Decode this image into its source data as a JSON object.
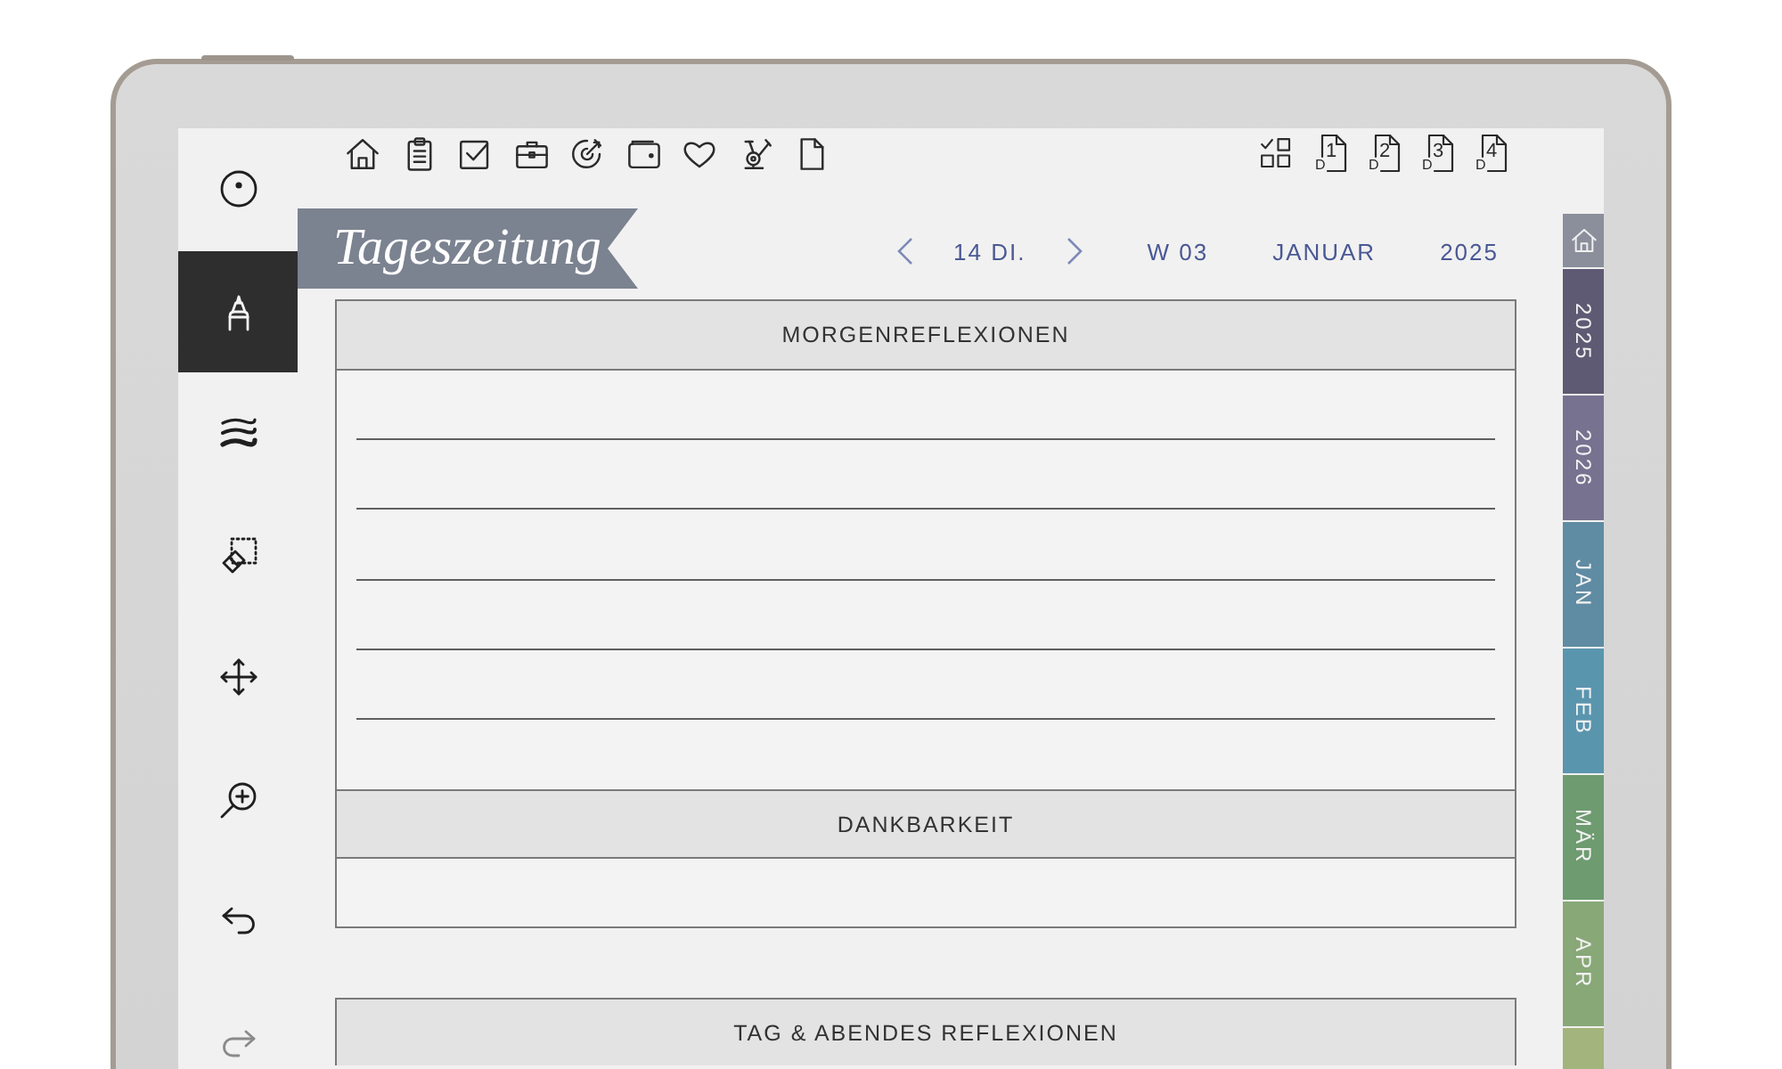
{
  "toolbar": {
    "left": [
      {
        "kind": "home"
      },
      {
        "kind": "clipboard"
      },
      {
        "kind": "checkbox"
      },
      {
        "kind": "briefcase"
      },
      {
        "kind": "target"
      },
      {
        "kind": "wallet"
      },
      {
        "kind": "heart"
      },
      {
        "kind": "bike"
      },
      {
        "kind": "page"
      }
    ],
    "right": [
      {
        "kind": "grid"
      },
      {
        "kind": "day_page",
        "letter": "D",
        "number": "1"
      },
      {
        "kind": "day_page",
        "letter": "D",
        "number": "2"
      },
      {
        "kind": "day_page",
        "letter": "D",
        "number": "3"
      },
      {
        "kind": "day_page",
        "letter": "D",
        "number": "4"
      }
    ]
  },
  "tools": [
    {
      "kind": "dot",
      "selected": false,
      "disabled": false
    },
    {
      "kind": "pen",
      "selected": true,
      "disabled": false
    },
    {
      "kind": "waves",
      "selected": false,
      "disabled": false
    },
    {
      "kind": "eraser",
      "selected": false,
      "disabled": false
    },
    {
      "kind": "move",
      "selected": false,
      "disabled": false
    },
    {
      "kind": "zoom",
      "selected": false,
      "disabled": false
    },
    {
      "kind": "undo",
      "selected": false,
      "disabled": false
    },
    {
      "kind": "redo",
      "selected": false,
      "disabled": true
    }
  ],
  "title": "Tageszeitung",
  "nav": {
    "day": "14 DI.",
    "week": "W 03",
    "month": "JANUAR",
    "year": "2025"
  },
  "blocks": [
    {
      "sections": [
        {
          "title": "MORGENREFLEXIONEN",
          "kind": "lined"
        },
        {
          "title": "DANKBARKEIT",
          "kind": "blank"
        }
      ]
    },
    {
      "sections": [
        {
          "title": "TAG & ABENDES REFLEXIONEN",
          "kind": "heading"
        }
      ]
    }
  ],
  "tabs": [
    {
      "kind": "home",
      "color": "#8a8f9b"
    },
    {
      "kind": "label",
      "label": "2025",
      "color": "#5e5a73"
    },
    {
      "kind": "label",
      "label": "2026",
      "color": "#777290"
    },
    {
      "kind": "label",
      "label": "JAN",
      "color": "#5f8ba3"
    },
    {
      "kind": "label",
      "label": "FEB",
      "color": "#5a95ae"
    },
    {
      "kind": "label",
      "label": "MÄR",
      "color": "#6e9b70"
    },
    {
      "kind": "label",
      "label": "APR",
      "color": "#88a877"
    },
    {
      "kind": "label",
      "color": "#a3b47c"
    }
  ]
}
